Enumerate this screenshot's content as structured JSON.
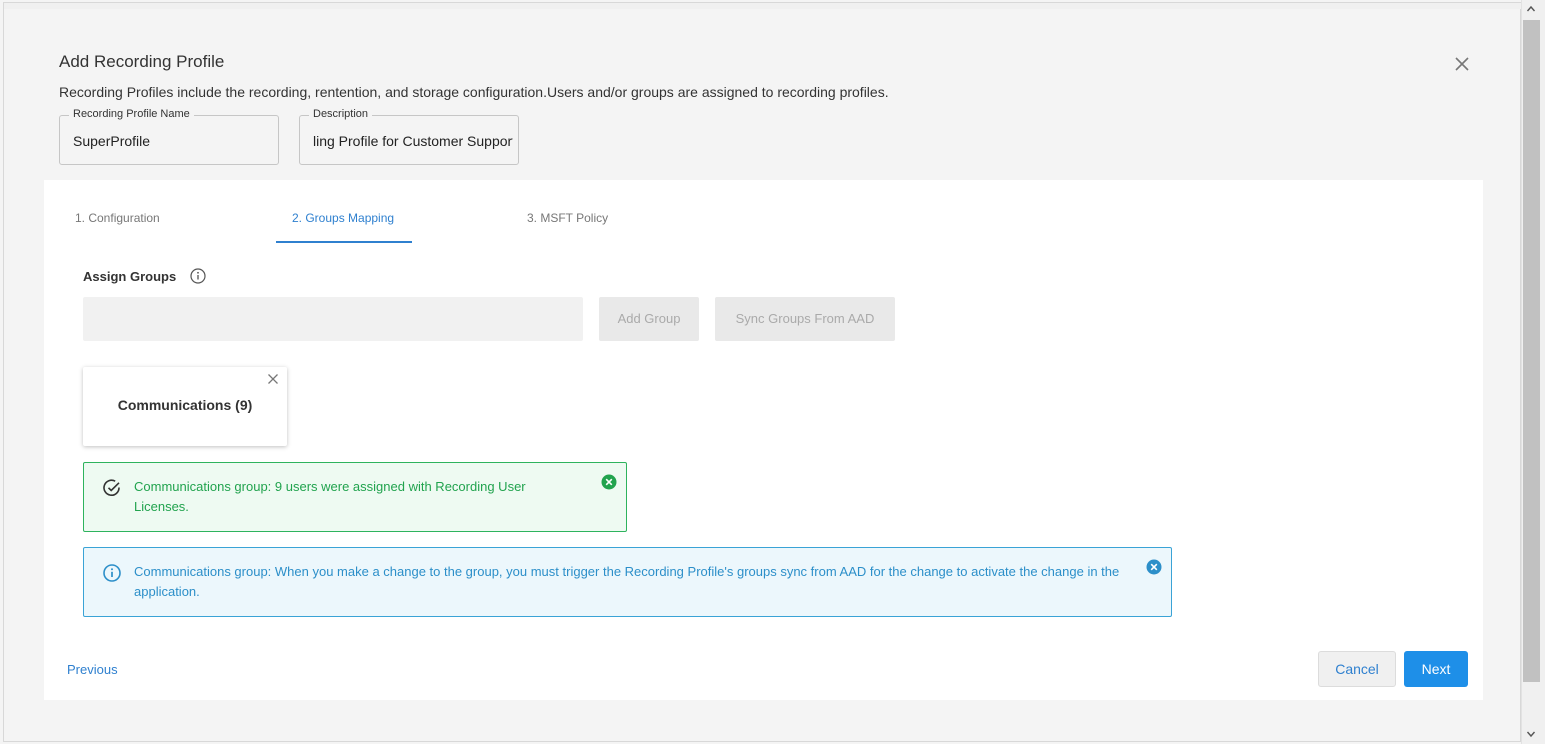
{
  "dialog": {
    "title": "Add Recording Profile",
    "subtitle": "Recording Profiles include the recording, rentention, and storage configuration.Users and/or groups are assigned to recording profiles."
  },
  "fields": {
    "name_label": "Recording Profile Name",
    "name_value": "SuperProfile",
    "description_label": "Description",
    "description_value": "ling Profile for Customer Support"
  },
  "tabs": [
    {
      "label": "1. Configuration"
    },
    {
      "label": "2. Groups Mapping"
    },
    {
      "label": "3. MSFT Policy"
    }
  ],
  "assign": {
    "label": "Assign Groups",
    "add_button": "Add Group",
    "sync_button": "Sync Groups From AAD"
  },
  "groups": [
    {
      "label": "Communications (9)"
    }
  ],
  "alerts": {
    "success_text": "Communications group: 9 users were assigned with Recording User Licenses.",
    "info_text": "Communications group: When you make a change to the group, you must trigger the Recording Profile's groups sync from AAD for the change to activate the change in the application."
  },
  "footer": {
    "previous": "Previous",
    "cancel": "Cancel",
    "next": "Next"
  },
  "colors": {
    "accent": "#1e8fe8",
    "success": "#21a34e",
    "info": "#2c8fc9"
  }
}
